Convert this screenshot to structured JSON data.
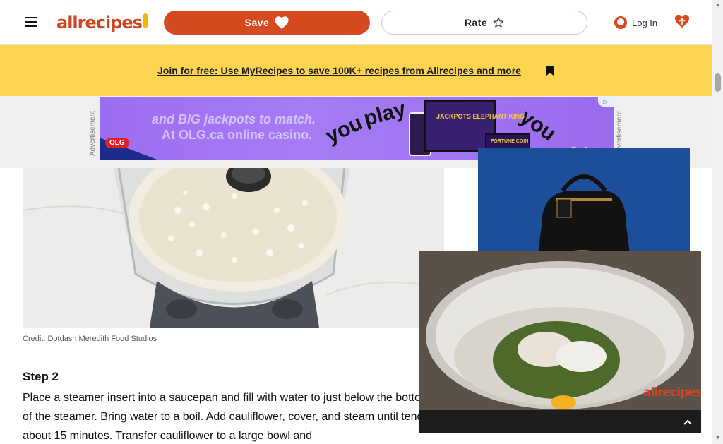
{
  "header": {
    "logo_text": "allrecipes",
    "save_label": "Save",
    "rate_label": "Rate",
    "login_label": "Log In"
  },
  "promo": {
    "link_text": "Join for free: Use MyRecipes to save 100K+ recipes from Allrecipes and more"
  },
  "ad": {
    "side_label": "Advertisement",
    "line1": "and BIG jackpots to match.",
    "line2": "At OLG.ca online casino.",
    "brand": "OLG",
    "word_you": "you",
    "word_play": "play",
    "game_title": "JACKPOTS ELEPHANT KING",
    "game_title_2": "FORTUNE COIN",
    "play_smart": "Play Smart",
    "adchoices": "▷"
  },
  "article": {
    "image_credit": "Credit: Dotdash Meredith Food Studios",
    "step_title": "Step 2",
    "step_text": "Place a steamer insert into a saucepan and fill with water to just below the bottom of the steamer. Bring water to a boil. Add cauliflower, cover, and steam until tender, about 15 minutes. Transfer cauliflower to a large bowl and"
  },
  "video": {
    "logo_text": "allrecipes"
  },
  "colors": {
    "brand_orange": "#d54a1e",
    "promo_yellow": "#fcd450",
    "ad_purple": "#9c6df2"
  }
}
